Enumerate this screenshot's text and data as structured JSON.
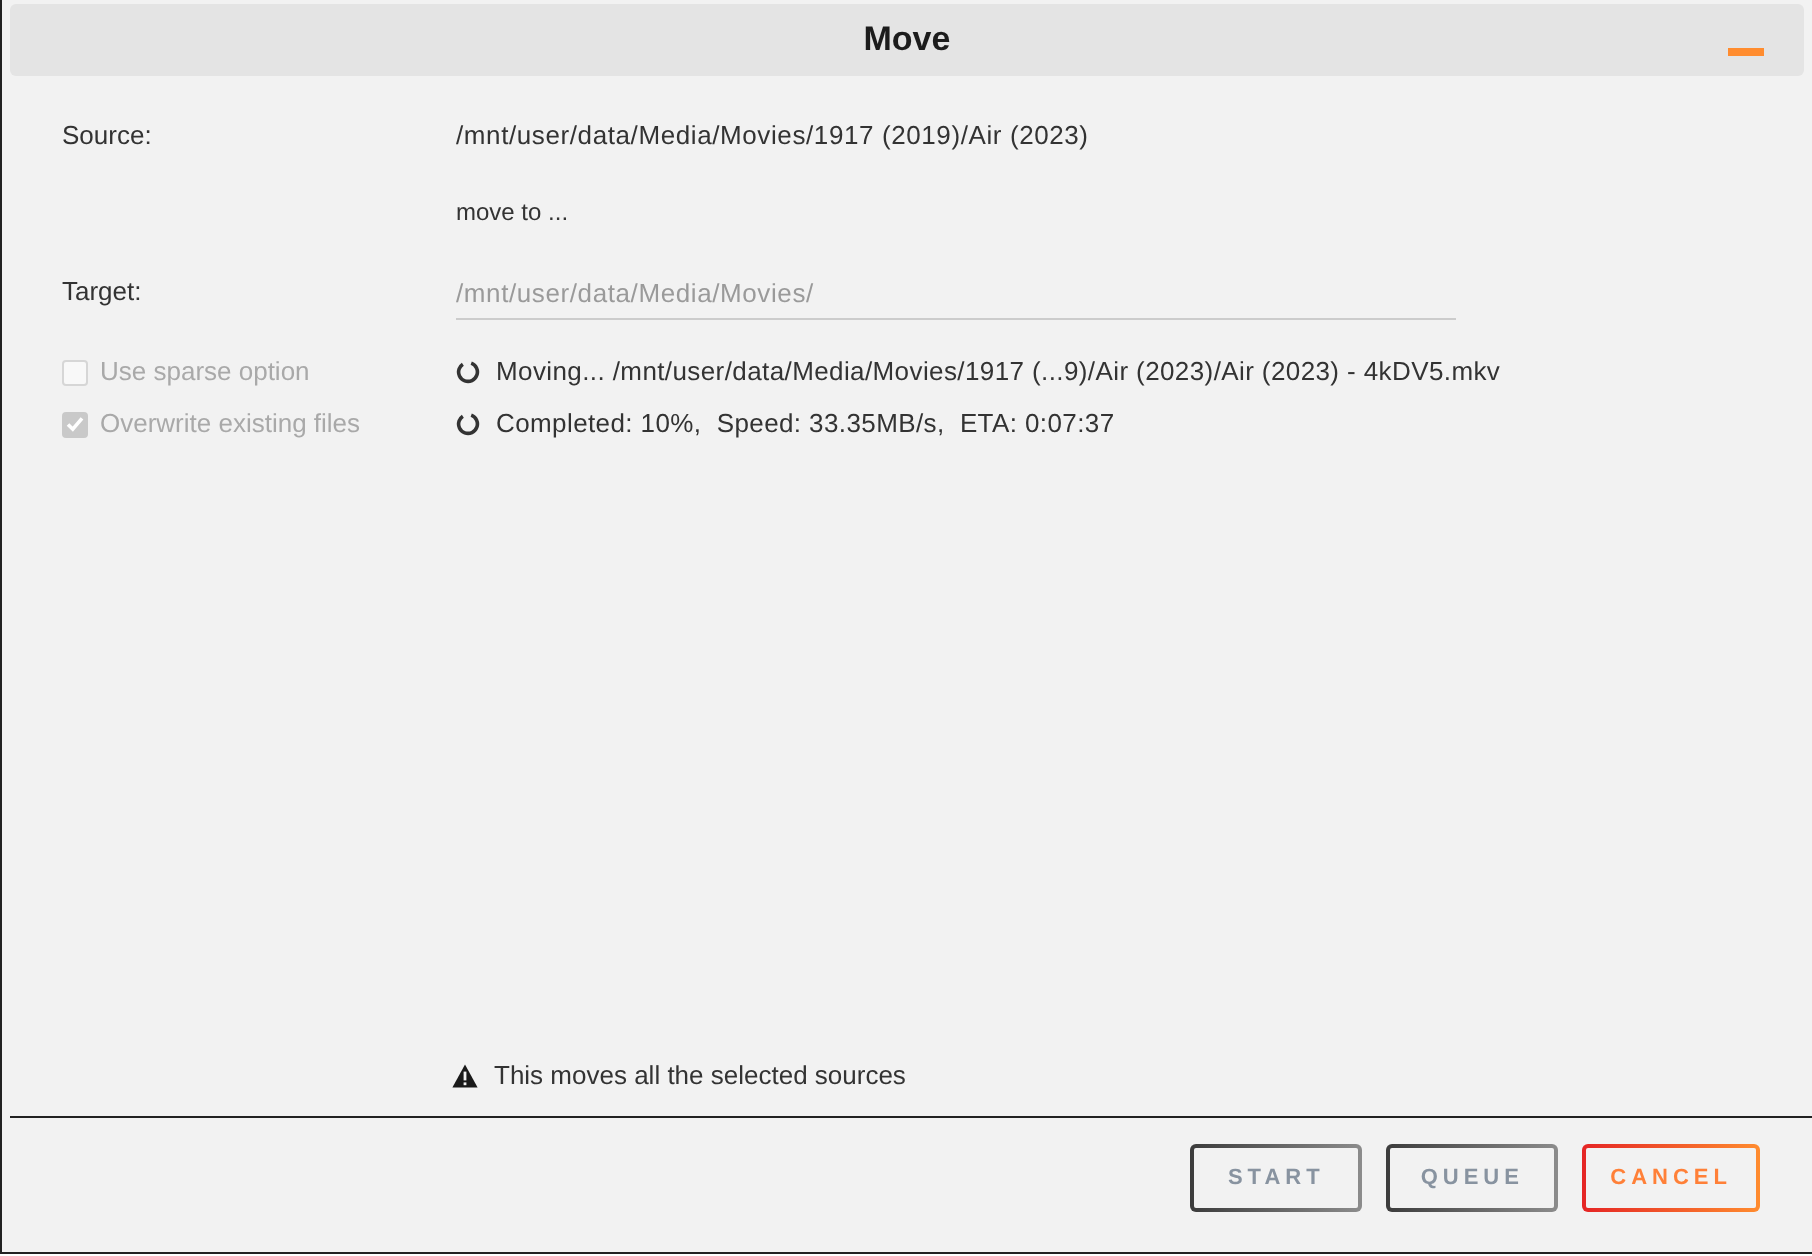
{
  "window": {
    "title": "Move"
  },
  "source": {
    "label": "Source:",
    "value": "/mnt/user/data/Media/Movies/1917 (2019)/Air (2023)"
  },
  "move_to": "move to ...",
  "target": {
    "label": "Target:",
    "value": "/mnt/user/data/Media/Movies/",
    "disabled": true
  },
  "options": [
    {
      "label": "Use sparse option",
      "checked": false,
      "disabled": true
    },
    {
      "label": "Overwrite existing files",
      "checked": true,
      "disabled": true
    }
  ],
  "progress": [
    {
      "text": "Moving... /mnt/user/data/Media/Movies/1917 (...9)/Air (2023)/Air (2023) - 4kDV5.mkv"
    },
    {
      "text": "Completed: 10%,  Speed: 33.35MB/s,  ETA: 0:07:37"
    }
  ],
  "notice": "This moves all the selected sources",
  "buttons": [
    {
      "label": "START",
      "kind": "neutral"
    },
    {
      "label": "QUEUE",
      "kind": "neutral"
    },
    {
      "label": "CANCEL",
      "kind": "cancel"
    }
  ]
}
